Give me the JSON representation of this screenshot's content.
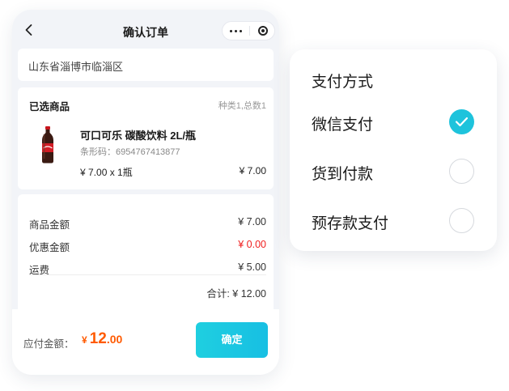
{
  "navbar": {
    "title": "确认订单"
  },
  "address": {
    "text": "山东省淄博市临淄区"
  },
  "goods": {
    "section_title": "已选商品",
    "count_text": "种类1,总数1",
    "product": {
      "name": "可口可乐 碳酸饮料 2L/瓶",
      "barcode": "条形码：6954767413877",
      "price_qty": "¥ 7.00 x 1瓶",
      "line_total": "¥ 7.00",
      "image_icon": "cola-bottle-icon"
    }
  },
  "summary": {
    "rows": [
      {
        "label": "商品金额",
        "value": "¥ 7.00"
      },
      {
        "label": "优惠金额",
        "value": "¥ 0.00"
      },
      {
        "label": "运费",
        "value": "¥ 5.00"
      }
    ],
    "total": "合计: ¥ 12.00"
  },
  "bottom": {
    "pay_label": "应付金额：",
    "currency": "¥",
    "amount_int": "12",
    "amount_dec": ".00",
    "confirm": "确定"
  },
  "payment_panel": {
    "title": "支付方式",
    "methods": [
      {
        "label": "微信支付",
        "selected": true
      },
      {
        "label": "货到付款",
        "selected": false
      },
      {
        "label": "预存款支付",
        "selected": false
      }
    ]
  },
  "colors": {
    "accent": "#1ec3dc",
    "price_orange": "#ff5a00",
    "discount_red": "#f02020",
    "page_bg": "#f2f4f8"
  }
}
